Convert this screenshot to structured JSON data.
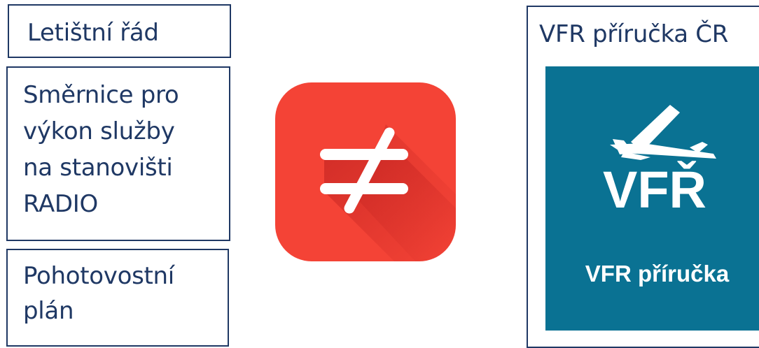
{
  "left_column": {
    "letistni_rad": "Letištní řád",
    "smernice": [
      "Směrnice pro",
      "výkon služby",
      "na stanovišti",
      "RADIO"
    ],
    "pohotovostni": [
      "Pohotovostní",
      "plán"
    ]
  },
  "center_icon": {
    "glyph": "≠",
    "icon_name": "not-equal-icon",
    "color": "#f44336"
  },
  "right_panel": {
    "title": "VFR příručka ČR",
    "tile_logo_text": "VFŘ",
    "tile_label": "VFR příručka",
    "tile_color": "#0a7293",
    "icon_name": "airplane-icon"
  },
  "colors": {
    "box_border": "#1f3864",
    "text": "#1f3864"
  }
}
